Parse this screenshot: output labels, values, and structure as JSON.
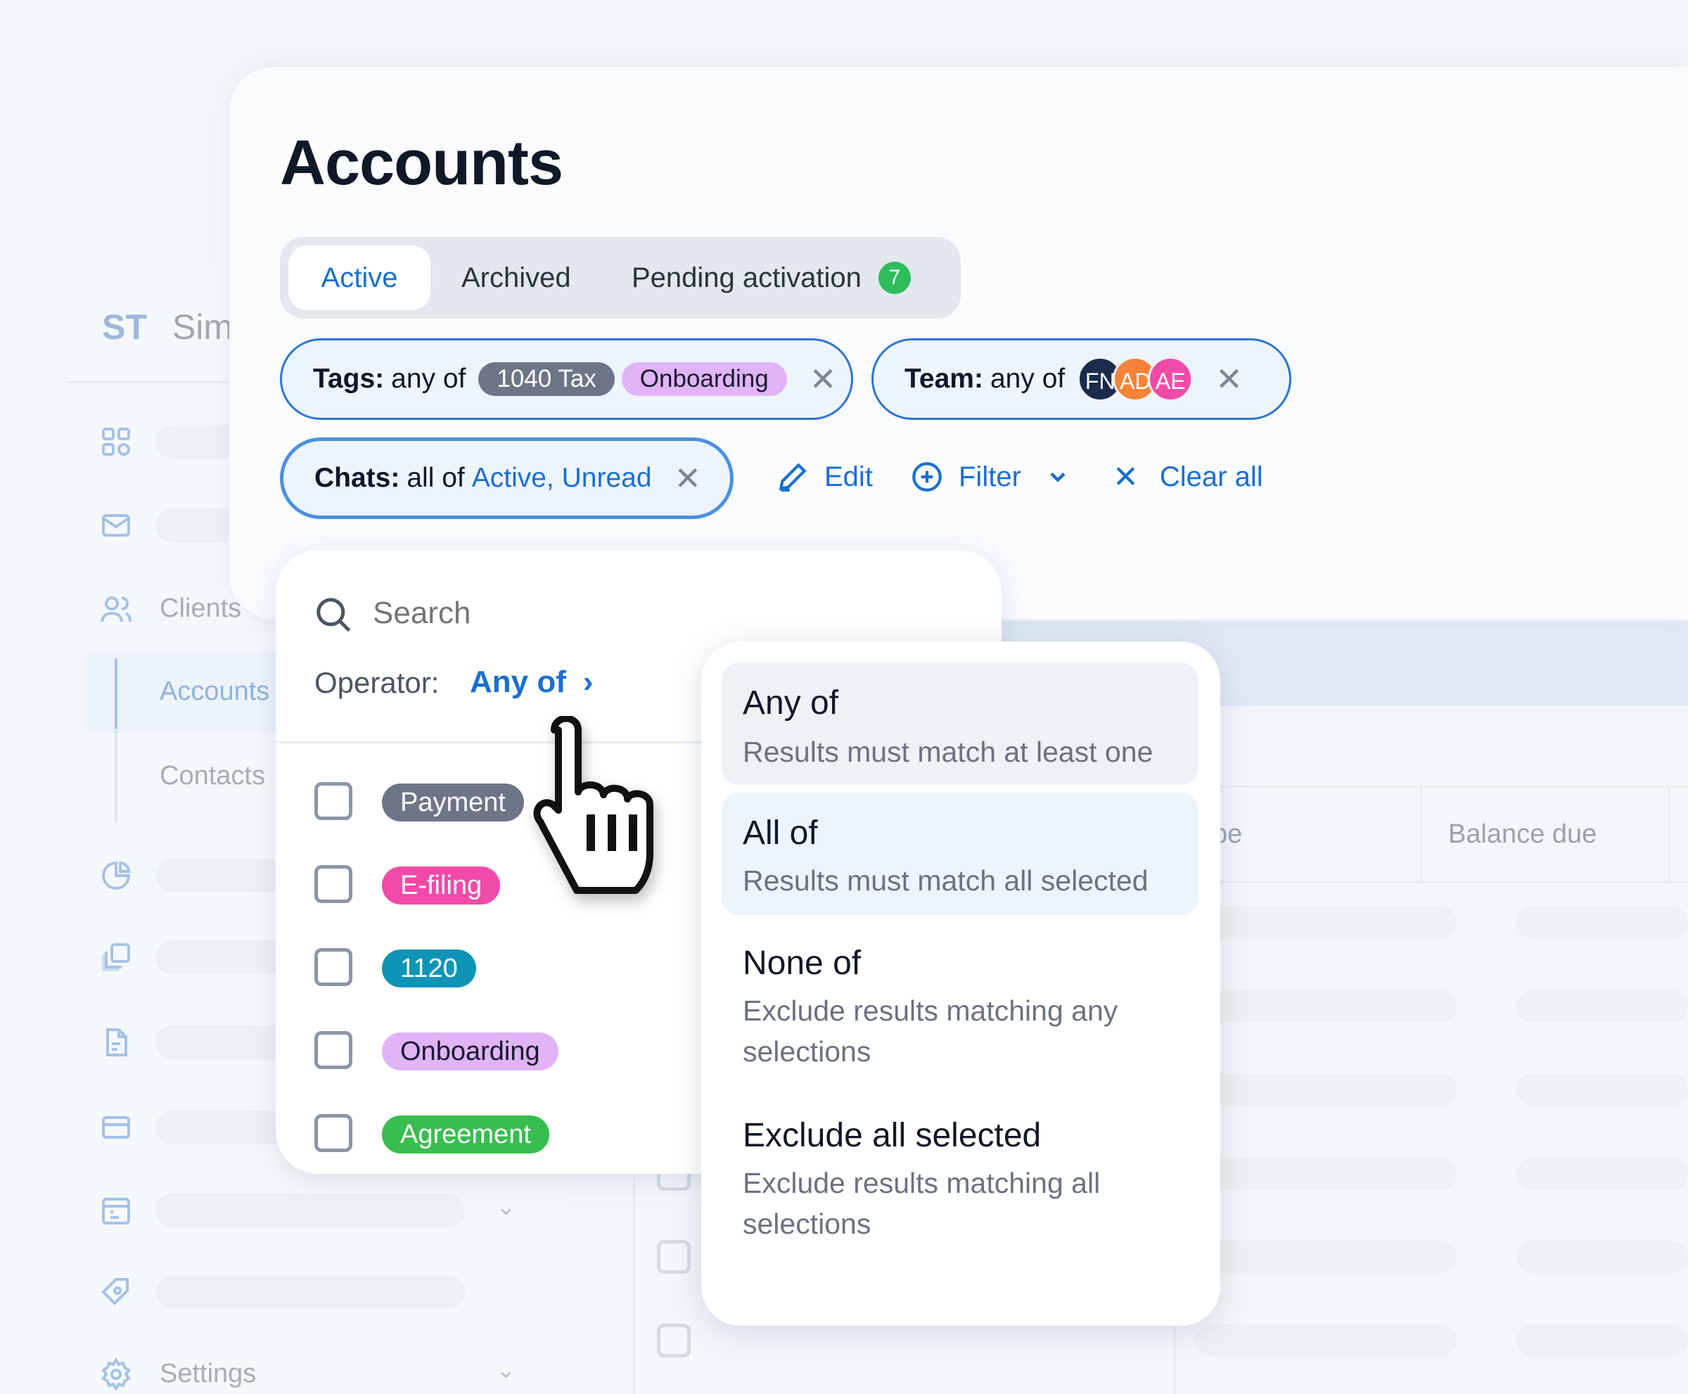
{
  "sidebar": {
    "brand_initials": "ST",
    "brand_name": "Sim",
    "items": [
      {
        "icon": "dashboard-icon"
      },
      {
        "icon": "mail-icon"
      },
      {
        "icon": "users-icon",
        "label": "Clients"
      },
      {
        "label": "Accounts"
      },
      {
        "label": "Contacts"
      },
      {
        "icon": "pie-chart-icon"
      },
      {
        "icon": "copy-icon"
      },
      {
        "icon": "document-icon"
      },
      {
        "icon": "card-icon"
      },
      {
        "icon": "calendar-icon"
      },
      {
        "icon": "tag-icon"
      },
      {
        "icon": "gear-icon",
        "label": "Settings"
      }
    ]
  },
  "page": {
    "title": "Accounts"
  },
  "tabs": [
    {
      "label": "Active",
      "active": true
    },
    {
      "label": "Archived"
    },
    {
      "label": "Pending activation",
      "count": "7"
    }
  ],
  "filters": {
    "tags": {
      "label": "Tags:",
      "operator": "any of",
      "values": [
        {
          "text": "1040 Tax",
          "color": "#6e7587"
        },
        {
          "text": "Onboarding",
          "color": "#e0b4f7"
        }
      ]
    },
    "team": {
      "label": "Team:",
      "operator": "any of",
      "members": [
        {
          "initials": "FN",
          "color": "#1c2b4b"
        },
        {
          "initials": "AD",
          "color": "#f4843a"
        },
        {
          "initials": "AE",
          "color": "#f24aa8"
        }
      ]
    },
    "chats": {
      "label": "Chats:",
      "operator": "all of",
      "values": "Active, Unread"
    }
  },
  "actions": {
    "edit": "Edit",
    "filter": "Filter",
    "clear_all": "Clear all"
  },
  "table": {
    "headers": [
      "ype",
      "Balance due"
    ]
  },
  "dropdown": {
    "search_placeholder": "Search",
    "operator_label": "Operator:",
    "operator_value": "Any of",
    "options": [
      {
        "text": "Payment",
        "color": "#6e7587",
        "fg": "#ffffff"
      },
      {
        "text": "E-filing",
        "color": "#f24aa8",
        "fg": "#ffffff"
      },
      {
        "text": "1120",
        "color": "#0e94b6",
        "fg": "#ffffff"
      },
      {
        "text": "Onboarding",
        "color": "#e0b4f7",
        "fg": "#1a1a2e"
      },
      {
        "text": "Agreement",
        "color": "#38bd4f",
        "fg": "#ffffff"
      }
    ]
  },
  "operator_menu": [
    {
      "title": "Any of",
      "description": "Results must match at least one",
      "state": "hover"
    },
    {
      "title": "All of",
      "description": "Results must match all selected",
      "state": "selected"
    },
    {
      "title": "None of",
      "description": "Exclude results matching any selections"
    },
    {
      "title": "Exclude all selected",
      "description": "Exclude results matching all selections"
    }
  ],
  "colors": {
    "accent": "#1b6fd0",
    "badge": "#2fbd5b"
  }
}
